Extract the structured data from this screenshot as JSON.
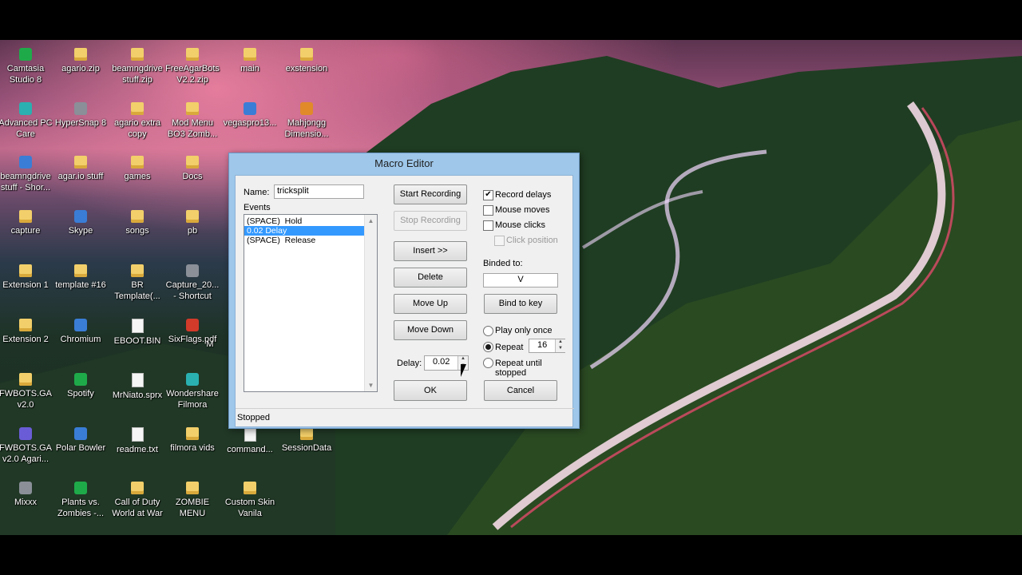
{
  "desktop": {
    "icons": [
      {
        "label": "Camtasia Studio 8",
        "icon": "camtasia-icon",
        "kind": "app green"
      },
      {
        "label": "agario.zip",
        "icon": "folder-icon",
        "kind": "folder"
      },
      {
        "label": "beamngdrive stuff.zip",
        "icon": "folder-icon",
        "kind": "folder"
      },
      {
        "label": "FreeAgarBots V2.2.zip",
        "icon": "folder-icon",
        "kind": "folder"
      },
      {
        "label": "main",
        "icon": "folder-icon",
        "kind": "folder"
      },
      {
        "label": "exstension",
        "icon": "folder-icon",
        "kind": "folder"
      },
      {
        "label": "Advanced PC Care",
        "icon": "pc-care-icon",
        "kind": "app teal"
      },
      {
        "label": "HyperSnap 8",
        "icon": "hypersnap-icon",
        "kind": "app gray"
      },
      {
        "label": "agario extra copy",
        "icon": "folder-icon",
        "kind": "folder"
      },
      {
        "label": "Mod Menu BO3 Zomb...",
        "icon": "folder-icon",
        "kind": "folder"
      },
      {
        "label": "vegaspro13...",
        "icon": "vegas-icon",
        "kind": "app"
      },
      {
        "label": "Mahjongg Dimensio...",
        "icon": "mahjongg-icon",
        "kind": "app orange"
      },
      {
        "label": "beamngdrive stuff - Shor...",
        "icon": "shortcut-icon",
        "kind": "app"
      },
      {
        "label": "agar.io stuff",
        "icon": "folder-icon",
        "kind": "folder"
      },
      {
        "label": "games",
        "icon": "folder-icon",
        "kind": "folder"
      },
      {
        "label": "Docs",
        "icon": "folder-icon",
        "kind": "folder"
      },
      {
        "label": "capture",
        "icon": "folder-icon",
        "kind": "folder"
      },
      {
        "label": "Skype",
        "icon": "skype-icon",
        "kind": "app"
      },
      {
        "label": "songs",
        "icon": "folder-icon",
        "kind": "folder"
      },
      {
        "label": "pb",
        "icon": "folder-icon",
        "kind": "folder"
      },
      {
        "label": "Extension 1",
        "icon": "folder-icon",
        "kind": "folder"
      },
      {
        "label": "template #16",
        "icon": "folder-icon",
        "kind": "folder"
      },
      {
        "label": "BR Template(...",
        "icon": "folder-icon",
        "kind": "folder"
      },
      {
        "label": "Capture_20... - Shortcut",
        "icon": "shortcut-icon",
        "kind": "app gray"
      },
      {
        "label": "Extension 2",
        "icon": "folder-icon",
        "kind": "folder"
      },
      {
        "label": "Chromium",
        "icon": "chromium-icon",
        "kind": "app"
      },
      {
        "label": "EBOOT.BIN",
        "icon": "file-icon",
        "kind": "file"
      },
      {
        "label": "SixFlags.pdf",
        "icon": "pdf-icon",
        "kind": "app red"
      },
      {
        "label": "FWBOTS.GA v2.0",
        "icon": "folder-icon",
        "kind": "folder"
      },
      {
        "label": "Spotify",
        "icon": "spotify-icon",
        "kind": "app green"
      },
      {
        "label": "MrNiato.sprx",
        "icon": "file-icon",
        "kind": "file"
      },
      {
        "label": "Wondershare Filmora",
        "icon": "filmora-icon",
        "kind": "app teal"
      },
      {
        "label": "FWBOTS.GA v2.0 Agari...",
        "icon": "fwbots-icon",
        "kind": "app purple"
      },
      {
        "label": "Polar Bowler",
        "icon": "polar-bowler-icon",
        "kind": "app"
      },
      {
        "label": "readme.txt",
        "icon": "text-file-icon",
        "kind": "file"
      },
      {
        "label": "filmora vids",
        "icon": "folder-icon",
        "kind": "folder"
      },
      {
        "label": "command...",
        "icon": "file-icon",
        "kind": "file"
      },
      {
        "label": "SessionData",
        "icon": "folder-icon",
        "kind": "folder"
      },
      {
        "label": "Mixxx",
        "icon": "mixxx-icon",
        "kind": "app gray"
      },
      {
        "label": "Plants vs. Zombies -...",
        "icon": "pvz-icon",
        "kind": "app green"
      },
      {
        "label": "Call of Duty World at War",
        "icon": "folder-icon",
        "kind": "folder"
      },
      {
        "label": "ZOMBIE MENU",
        "icon": "folder-icon",
        "kind": "folder"
      },
      {
        "label": "Custom Skin Vanila",
        "icon": "folder-icon",
        "kind": "folder"
      }
    ],
    "partial_label": "M"
  },
  "dialog": {
    "title": "Macro Editor",
    "name_label": "Name:",
    "name_value": "tricksplit",
    "events_label": "Events",
    "events": [
      {
        "text": "(SPACE)  Hold",
        "selected": false
      },
      {
        "text": "0.02 Delay",
        "selected": true
      },
      {
        "text": "(SPACE)  Release",
        "selected": false
      }
    ],
    "buttons": {
      "start_recording": "Start Recording",
      "stop_recording": "Stop Recording",
      "insert": "Insert >>",
      "delete": "Delete",
      "move_up": "Move Up",
      "move_down": "Move Down",
      "ok": "OK",
      "cancel": "Cancel",
      "bind_to_key": "Bind to key"
    },
    "delay_label": "Delay:",
    "delay_value": "0.02",
    "options": {
      "record_delays": "Record delays",
      "mouse_moves": "Mouse moves",
      "mouse_clicks": "Mouse clicks",
      "click_position": "Click position"
    },
    "binded_label": "Binded to:",
    "binded_value": "V",
    "play_once": "Play only once",
    "repeat": "Repeat",
    "repeat_count": "16",
    "repeat_until_stopped": "Repeat until stopped",
    "status": "Stopped"
  }
}
